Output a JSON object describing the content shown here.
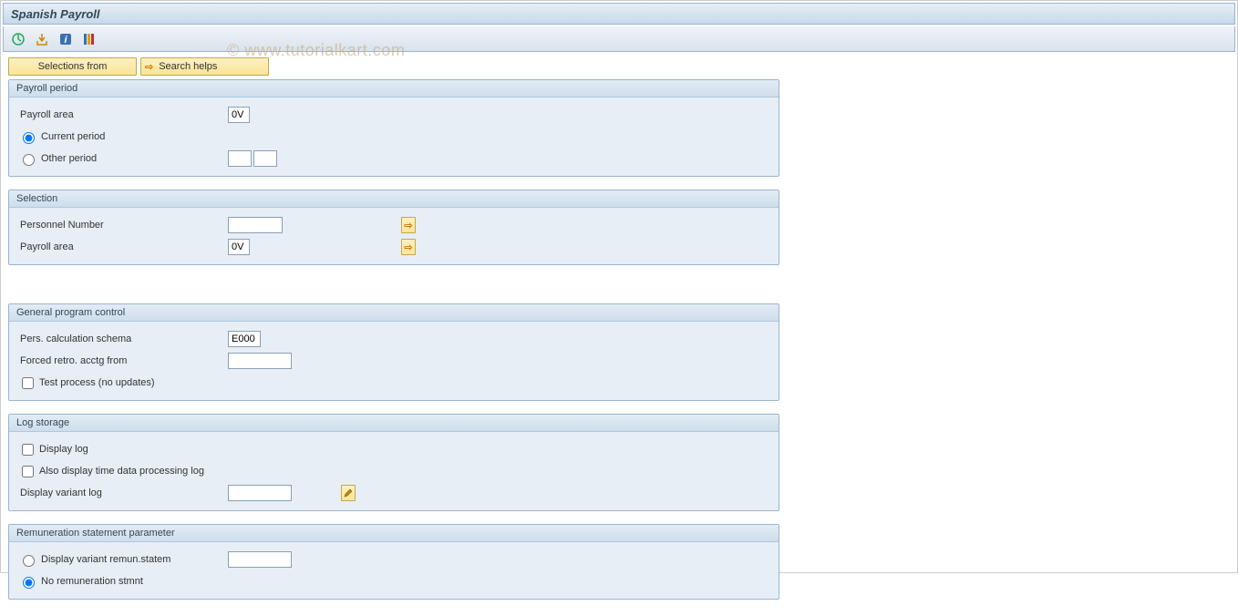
{
  "watermark": "© www.tutorialkart.com",
  "title": "Spanish Payroll",
  "toolbar_icons": [
    "execute-icon",
    "get-variant-icon",
    "info-icon",
    "grid-icon"
  ],
  "buttons": {
    "selections_from": "Selections from",
    "search_helps": "Search helps"
  },
  "groups": {
    "payroll_period": {
      "title": "Payroll period",
      "labels": {
        "payroll_area": "Payroll area",
        "current_period": "Current period",
        "other_period": "Other period"
      },
      "values": {
        "payroll_area": "0V"
      },
      "radio": {
        "current": true,
        "other": false
      }
    },
    "selection": {
      "title": "Selection",
      "labels": {
        "personnel_number": "Personnel Number",
        "payroll_area": "Payroll area"
      },
      "values": {
        "personnel_number": "",
        "payroll_area": "0V"
      }
    },
    "general_program_control": {
      "title": "General program control",
      "labels": {
        "pers_calc_schema": "Pers. calculation schema",
        "forced_retro": "Forced retro. acctg from",
        "test_process": "Test process (no updates)"
      },
      "values": {
        "pers_calc_schema": "E000",
        "forced_retro": ""
      },
      "check": {
        "test_process": false
      }
    },
    "log_storage": {
      "title": "Log storage",
      "labels": {
        "display_log": "Display log",
        "also_display_time": "Also display time data processing log",
        "display_variant_log": "Display variant log"
      },
      "values": {
        "display_variant_log": ""
      },
      "check": {
        "display_log": false,
        "also_display_time": false
      }
    },
    "remuneration": {
      "title": "Remuneration statement parameter",
      "labels": {
        "display_variant": "Display variant remun.statem",
        "no_remun": "No remuneration stmnt"
      },
      "values": {
        "display_variant": ""
      },
      "radio": {
        "display_variant": false,
        "no_remun": true
      }
    }
  }
}
